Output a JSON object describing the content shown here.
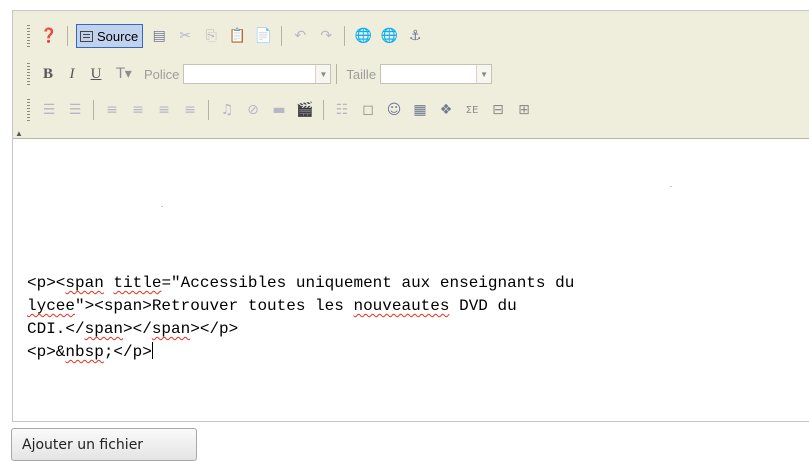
{
  "toolbar": {
    "source_label": "Source",
    "bold_label": "B",
    "italic_label": "I",
    "underline_label": "U",
    "font_label": "Police",
    "font_value": "",
    "size_label": "Taille",
    "size_value": ""
  },
  "editor": {
    "line1": "<p><span title=\"Accessibles uniquement aux enseignants du",
    "line2_w1": "lycee",
    "line2_rest": "\"><span>Retrouver toutes les ",
    "line2_w2": "nouveautes",
    "line2_end": " DVD du",
    "line3": "CDI.</span></span></p>",
    "line4": "<p>&nbsp;</p>"
  },
  "attach_button_label": "Ajouter un fichier"
}
